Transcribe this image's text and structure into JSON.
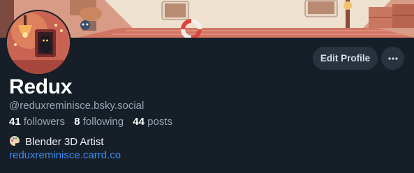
{
  "profile": {
    "display_name": "Redux",
    "handle": "@reduxreminisce.bsky.social",
    "bio_emoji": "palette-icon",
    "bio_text": "Blender 3D Artist",
    "link_text": "reduxreminisce.carrd.co"
  },
  "stats": {
    "followers_count": "41",
    "followers_label": "followers",
    "following_count": "8",
    "following_label": "following",
    "posts_count": "44",
    "posts_label": "posts"
  },
  "actions": {
    "edit_profile_label": "Edit Profile",
    "more_icon": "more-horizontal-icon"
  },
  "colors": {
    "background": "#161e27",
    "button_bg": "#29333f",
    "link": "#3d8df5",
    "muted_text": "#9aa6b4"
  }
}
